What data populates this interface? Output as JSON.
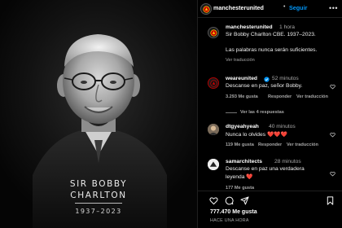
{
  "post": {
    "memorial_line1": "SIR BOBBY",
    "memorial_line2": "CHARLTON",
    "memorial_years": "1937–2023"
  },
  "header": {
    "username": "manchesterunited",
    "separator": "•",
    "follow_label": "Seguir",
    "more_icon": "more-horizontal-icon"
  },
  "caption": {
    "username": "manchesterunited",
    "time": "1 hora",
    "line1": "Sir Bobby Charlton CBE. 1937–2023.",
    "line2": "Las palabras nunca serán suficientes.",
    "see_translation": "Ver traducción"
  },
  "comments": [
    {
      "username": "weareunited",
      "time": "52 minutos",
      "text": "Descanse en paz, señor Bobby.",
      "likes": "3.293 Me gusta",
      "reply": "Responder",
      "see_translation": "Ver traducción",
      "view_replies": "Ver las 4 respuestas"
    },
    {
      "username": "dtgyeahyeah",
      "time": "40 minutos",
      "text": "Nunca lo olvides",
      "hearts": "❤️❤️❤️",
      "likes": "119 Me gusta",
      "reply": "Responder",
      "see_translation": "Ver traducción"
    },
    {
      "username": "samarchitects",
      "time": "28 minutos",
      "text_line1": "Descanse en paz una verdadera",
      "text_line2": "leyenda",
      "hearts": "❤️",
      "likes_partial": "177 Me gusta"
    }
  ],
  "footer": {
    "likes": "777.470 Me gusta",
    "time_ago": "HACE UNA HORA"
  },
  "colors": {
    "accent": "#0095f6",
    "heart": "#ed4956",
    "background": "#000000",
    "muted": "#a8a8a8"
  }
}
